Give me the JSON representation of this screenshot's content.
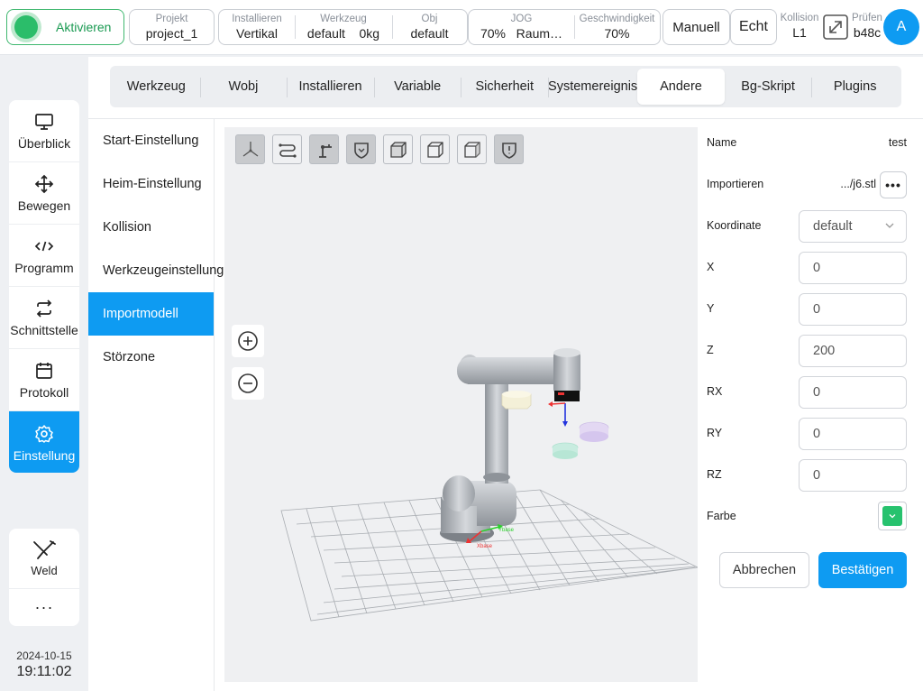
{
  "topbar": {
    "activate_label": "Aktivieren",
    "project": {
      "key": "Projekt",
      "value": "project_1"
    },
    "install": {
      "key": "Installieren",
      "value": "Vertikal"
    },
    "tool": {
      "key": "Werkzeug",
      "value": "default",
      "load": "0kg"
    },
    "obj": {
      "key": "Obj",
      "value": "default"
    },
    "jog": {
      "key": "JOG",
      "value": "70%",
      "space": "Raum…"
    },
    "speed": {
      "key": "Geschwindigkeit",
      "value": "70%"
    },
    "manual_label": "Manuell",
    "real_label": "Echt",
    "collision": {
      "key": "Kollision",
      "value": "L1"
    },
    "check": {
      "key": "Prüfen",
      "value": "b48c"
    },
    "avatar": "A"
  },
  "nav": {
    "items": [
      {
        "label": "Überblick",
        "icon": "monitor-icon"
      },
      {
        "label": "Bewegen",
        "icon": "move-icon"
      },
      {
        "label": "Programm",
        "icon": "code-icon"
      },
      {
        "label": "Schnittstelle",
        "icon": "interface-icon"
      },
      {
        "label": "Protokoll",
        "icon": "calendar-icon"
      },
      {
        "label": "Einstellung",
        "icon": "gear-icon"
      }
    ],
    "weld_label": "Weld",
    "more_label": "···"
  },
  "datetime": {
    "date": "2024-10-15",
    "time": "19:11:02"
  },
  "tabs": [
    "Werkzeug",
    "Wobj",
    "Installieren",
    "Variable",
    "Sicherheit",
    "Systemereignis",
    "Andere",
    "Bg-Skript",
    "Plugins"
  ],
  "active_tab": "Andere",
  "sublist": [
    "Start-Einstellung",
    "Heim-Einstellung",
    "Kollision",
    "Werkzeugeinstellung",
    "Importmodell",
    "Störzone"
  ],
  "active_sub": "Importmodell",
  "scene": {
    "base_x_label": "Xbase",
    "base_y_label": "Ybase"
  },
  "form": {
    "name_label": "Name",
    "name_value": "test",
    "import_label": "Importieren",
    "import_value": ".../j6.stl",
    "coord_label": "Koordinate",
    "coord_value": "default",
    "x_label": "X",
    "x_value": "0",
    "y_label": "Y",
    "y_value": "0",
    "z_label": "Z",
    "z_value": "200",
    "rx_label": "RX",
    "rx_value": "0",
    "ry_label": "RY",
    "ry_value": "0",
    "rz_label": "RZ",
    "rz_value": "0",
    "color_label": "Farbe",
    "color_value": "#27c26e",
    "cancel_label": "Abbrechen",
    "confirm_label": "Bestätigen"
  },
  "colors": {
    "accent": "#0e9bf2",
    "active_green": "#2bbd6a"
  }
}
